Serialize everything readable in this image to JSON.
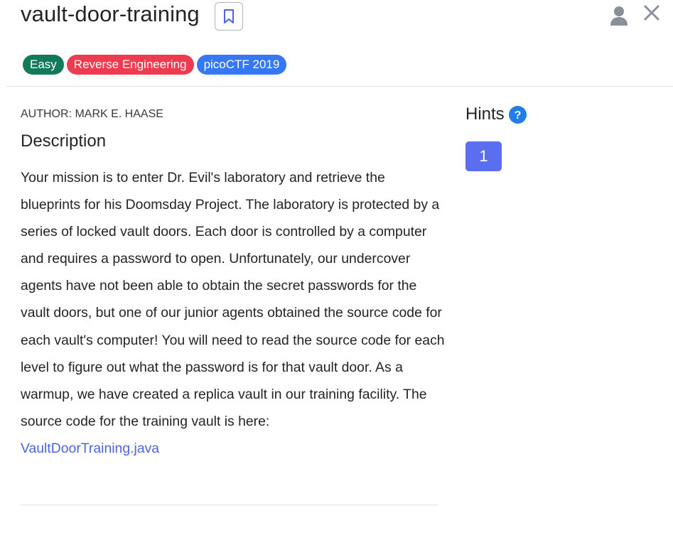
{
  "challenge": {
    "title": "vault-door-training",
    "author": "AUTHOR: MARK E. HAASE"
  },
  "tags": [
    {
      "label": "Easy",
      "color": "#117a5b"
    },
    {
      "label": "Reverse Engineering",
      "color": "#ee3b4f"
    },
    {
      "label": "picoCTF 2019",
      "color": "#3478f6"
    }
  ],
  "description": {
    "heading": "Description",
    "text": "Your mission is to enter Dr. Evil's laboratory and retrieve the blueprints for his Doomsday Project. The laboratory is protected by a series of locked vault doors. Each door is controlled by a computer and requires a password to open. Unfortunately, our undercover agents have not been able to obtain the secret passwords for the vault doors, but one of our junior agents obtained the source code for each vault's computer! You will need to read the source code for each level to figure out what the password is for that vault door. As a warmup, we have created a replica vault in our training facility. The source code for the training vault is here:",
    "link_text": "VaultDoorTraining.java"
  },
  "hints": {
    "heading": "Hints",
    "help_icon": "question-circle-icon",
    "buttons": [
      "1"
    ]
  },
  "header_icons": {
    "bookmark": "bookmark-icon",
    "user": "user-icon",
    "close": "close-icon"
  },
  "colors": {
    "link": "#4d63e6",
    "hint_button": "#5c6ef0",
    "help_icon": "#1f7ee8",
    "icon_gray": "#8a9099"
  }
}
